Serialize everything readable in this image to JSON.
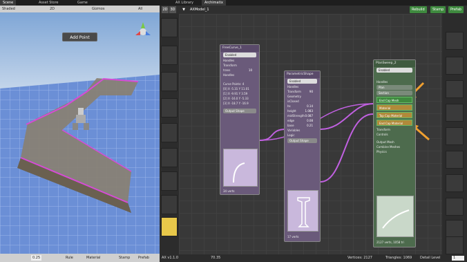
{
  "tabs": {
    "scene": "Scene",
    "asset_store": "Asset Store",
    "game": "Game",
    "ax_library": "AX Library",
    "archimatix": "Archimatix"
  },
  "scene_toolbar": {
    "shading": "Shaded",
    "mode_2d": "2D",
    "gizmos": "Gizmos",
    "search": "All"
  },
  "add_point": "Add Point",
  "scene_bottom": {
    "grid_value": "0.25",
    "rule": "Rule",
    "material": "Material",
    "stamp": "Stamp",
    "prefab": "Prefab"
  },
  "editor": {
    "toggle_2d": "2D",
    "toggle_3d": "3D",
    "model_name": "AXModel_1",
    "rebuild": "Rebuild",
    "stamp": "Stamp",
    "prefab": "Prefab",
    "version": "AX v1.1.0",
    "zoom": "70.35",
    "vertices": "Vertices: 2127",
    "triangles": "Triangles: 1069",
    "detail_label": "Detail Level",
    "detail_value": "1"
  },
  "nodes": {
    "freecurve": {
      "title": "FreeCurve_1",
      "enabled": "Enabled",
      "handles": "Handles",
      "transform": "Transform",
      "trans_label": "trans",
      "trans_value": "10",
      "handles2": "Handles",
      "curve_points": "Curve Points: 4",
      "pts": [
        "[0] X -5.31  Y 11.01",
        "[1] X -9.91  Y 3.59",
        "[2] X -16.0  Y -5.33",
        "[3] X -18.7  Y -16.9"
      ],
      "output": "Output Shape",
      "verts": "34 verts"
    },
    "param": {
      "title": "ParametricShape",
      "enabled": "Enabled",
      "handles": "Handles",
      "transform": "Transform",
      "transform_value": "90",
      "geometry": "Geometry",
      "rows": [
        {
          "label": "isClosed",
          "value": ""
        },
        {
          "label": "hs",
          "value": "0.14"
        },
        {
          "label": "height",
          "value": "1.083"
        },
        {
          "label": "midStrength",
          "value": "0.087"
        },
        {
          "label": "edge",
          "value": "0.08"
        },
        {
          "label": "base",
          "value": "0.21"
        }
      ],
      "variables": "Variables",
      "logic": "Logic",
      "output": "Output Shape",
      "verts": "17 verts"
    },
    "plansweep": {
      "title": "PlanSweep_2",
      "enabled": "Enabled",
      "handles": "Handles",
      "plan": "Plan",
      "section": "Section",
      "end_cap": "End Cap Mesh",
      "material": "Material",
      "top_cap": "Top Cap Material",
      "end_cap_mat": "End Cap Material",
      "transform": "Transform",
      "controls": "Controls",
      "output_mesh": "Output Mesh",
      "combine": "Combine Meshes",
      "physics": "Physics",
      "stats": "2127 verts, 1058 tri"
    }
  },
  "colors": {
    "accent_green": "#3f8a3f",
    "node_purple": "#6a5a7a",
    "node_green": "#4d6b4d",
    "wire_magenta": "#c060e0",
    "arrow_orange": "#f0a030"
  }
}
